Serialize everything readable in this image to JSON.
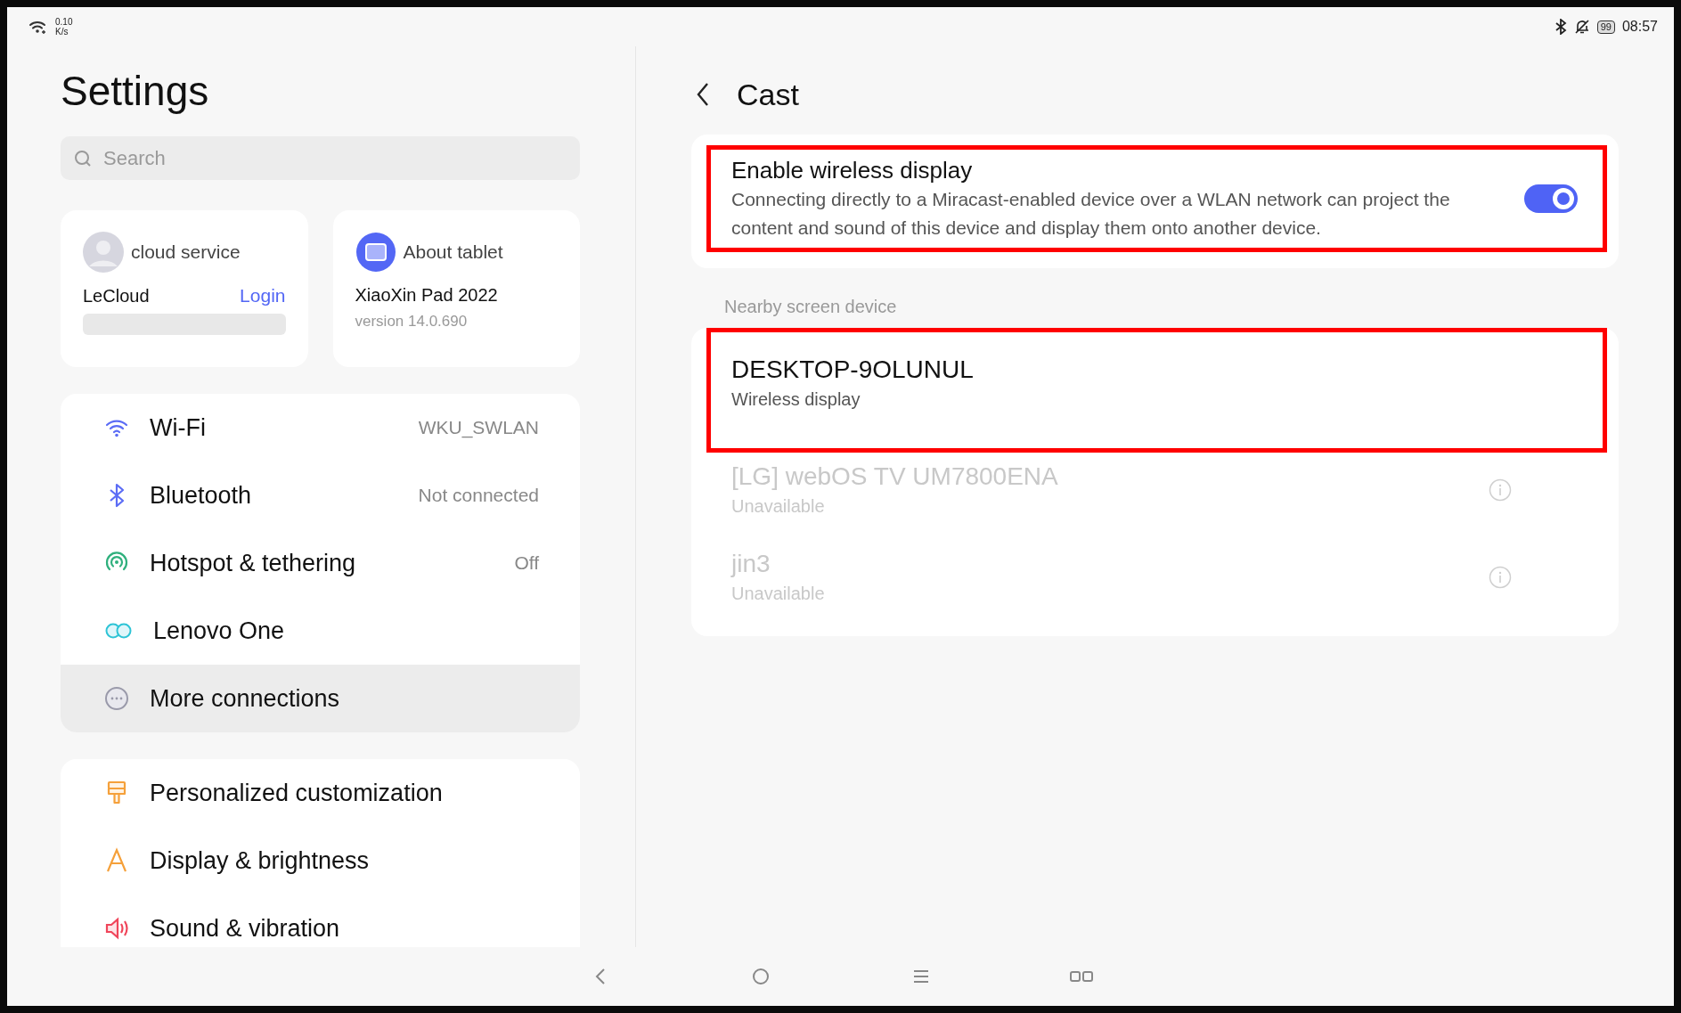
{
  "status_bar": {
    "speed": "0.10",
    "speed_unit": "K/s",
    "battery": "99",
    "time": "08:57"
  },
  "sidebar": {
    "title": "Settings",
    "search": {
      "placeholder": "Search"
    },
    "account_card": {
      "title": "cloud service",
      "name": "LeCloud",
      "action": "Login"
    },
    "about_card": {
      "title": "About tablet",
      "device": "XiaoXin Pad 2022",
      "version": "version 14.0.690"
    },
    "groups": [
      {
        "items": [
          {
            "kind": "wifi",
            "label": "Wi-Fi",
            "value": "WKU_SWLAN",
            "selected": false
          },
          {
            "kind": "bluetooth",
            "label": "Bluetooth",
            "value": "Not connected",
            "selected": false
          },
          {
            "kind": "hotspot",
            "label": "Hotspot & tethering",
            "value": "Off",
            "selected": false
          },
          {
            "kind": "lenovo",
            "label": "Lenovo One",
            "selected": false
          },
          {
            "kind": "more",
            "label": "More connections",
            "selected": true
          }
        ]
      },
      {
        "items": [
          {
            "kind": "personalize",
            "label": "Personalized customization",
            "selected": false
          },
          {
            "kind": "display",
            "label": "Display & brightness",
            "selected": false
          },
          {
            "kind": "sound",
            "label": "Sound & vibration",
            "selected": false
          }
        ]
      }
    ]
  },
  "detail": {
    "title": "Cast",
    "toggle_card": {
      "title": "Enable wireless display",
      "description": "Connecting directly to a Miracast-enabled device over a WLAN network can project the content and sound of this device and display them onto another device.",
      "on": true,
      "highlighted": true
    },
    "section_label": "Nearby screen device",
    "devices": [
      {
        "name": "DESKTOP-9OLUNUL",
        "status": "Wireless display",
        "disabled": false,
        "highlighted": true
      },
      {
        "name": "[LG] webOS TV UM7800ENA",
        "status": "Unavailable",
        "disabled": true,
        "highlighted": false
      },
      {
        "name": "jin3",
        "status": "Unavailable",
        "disabled": true,
        "highlighted": false
      }
    ]
  }
}
